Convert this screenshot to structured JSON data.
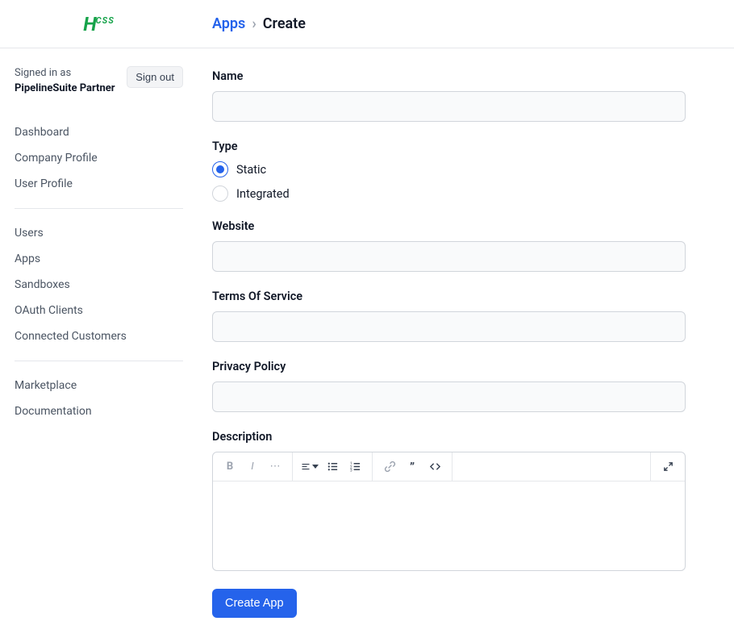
{
  "logo": {
    "main": "H",
    "sup": "CSS"
  },
  "breadcrumb": {
    "apps": "Apps",
    "chevron": "›",
    "current": "Create"
  },
  "sidebar": {
    "signed_in_label": "Signed in as",
    "signed_in_name": "PipelineSuite Partner",
    "sign_out": "Sign out",
    "nav1": {
      "dashboard": "Dashboard",
      "company_profile": "Company Profile",
      "user_profile": "User Profile"
    },
    "nav2": {
      "users": "Users",
      "apps": "Apps",
      "sandboxes": "Sandboxes",
      "oauth_clients": "OAuth Clients",
      "connected_customers": "Connected Customers"
    },
    "nav3": {
      "marketplace": "Marketplace",
      "documentation": "Documentation"
    }
  },
  "form": {
    "name_label": "Name",
    "type_label": "Type",
    "type_static": "Static",
    "type_integrated": "Integrated",
    "website_label": "Website",
    "tos_label": "Terms Of Service",
    "privacy_label": "Privacy Policy",
    "description_label": "Description",
    "submit": "Create App"
  }
}
